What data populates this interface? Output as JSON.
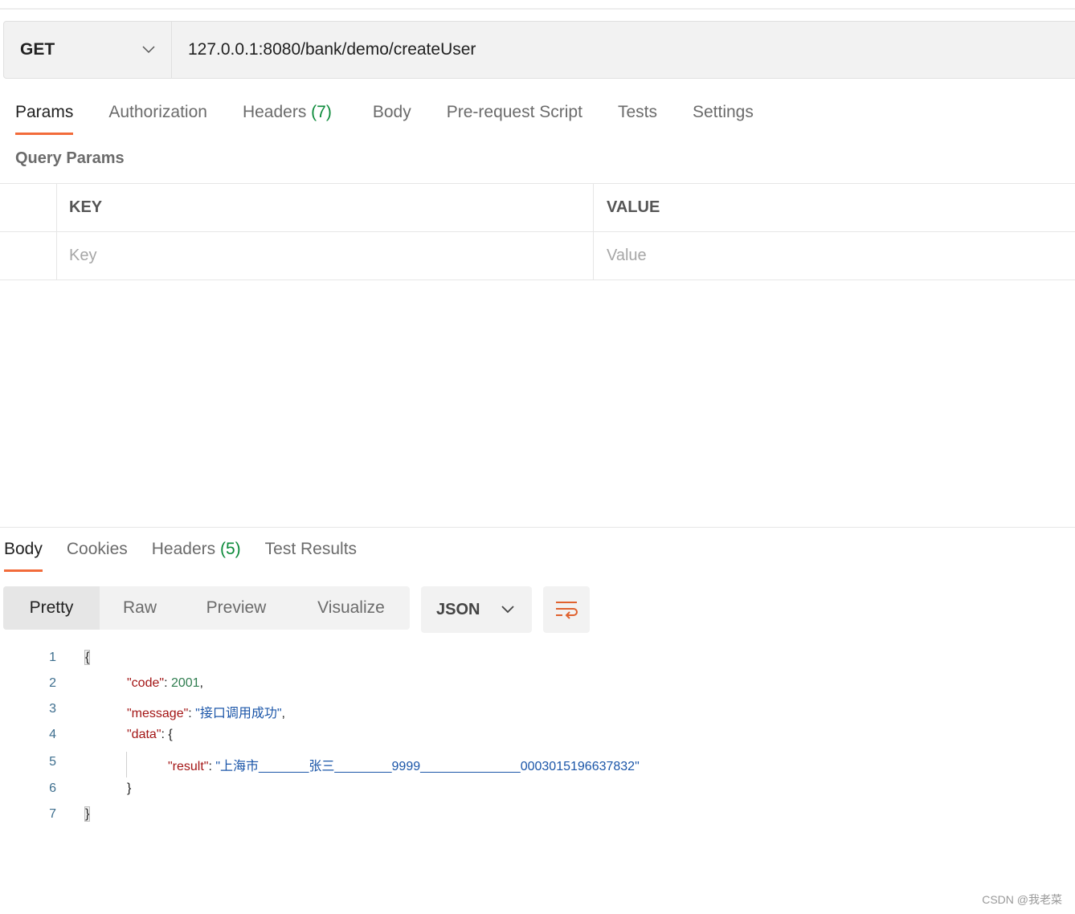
{
  "request": {
    "method": "GET",
    "url": "127.0.0.1:8080/bank/demo/createUser"
  },
  "request_tabs": [
    {
      "label": "Params"
    },
    {
      "label": "Authorization"
    },
    {
      "label": "Headers",
      "count": "(7)"
    },
    {
      "label": "Body"
    },
    {
      "label": "Pre-request Script"
    },
    {
      "label": "Tests"
    },
    {
      "label": "Settings"
    }
  ],
  "query_params": {
    "title": "Query Params",
    "headers": {
      "key": "KEY",
      "value": "VALUE"
    },
    "placeholders": {
      "key": "Key",
      "value": "Value"
    }
  },
  "response_tabs": [
    {
      "label": "Body"
    },
    {
      "label": "Cookies"
    },
    {
      "label": "Headers",
      "count": "(5)"
    },
    {
      "label": "Test Results"
    }
  ],
  "view_modes": [
    "Pretty",
    "Raw",
    "Preview",
    "Visualize"
  ],
  "format": "JSON",
  "body_lines": {
    "l1": "{",
    "l2k": "\"code\"",
    "l2v": "2001",
    "l3k": "\"message\"",
    "l3v": "\"接口调用成功\"",
    "l4k": "\"data\"",
    "l5k": "\"result\"",
    "l5v": "\"上海市_______张三________9999______________0003015196637832\"",
    "l6": "}",
    "l7": "}"
  },
  "line_numbers": [
    "1",
    "2",
    "3",
    "4",
    "5",
    "6",
    "7"
  ],
  "watermark": "CSDN @我老菜",
  "colors": {
    "accent": "#f26b3a",
    "count": "#0c8a3a",
    "json_key": "#a31515",
    "json_number": "#2f7d4f",
    "json_string": "#1a55a8"
  }
}
